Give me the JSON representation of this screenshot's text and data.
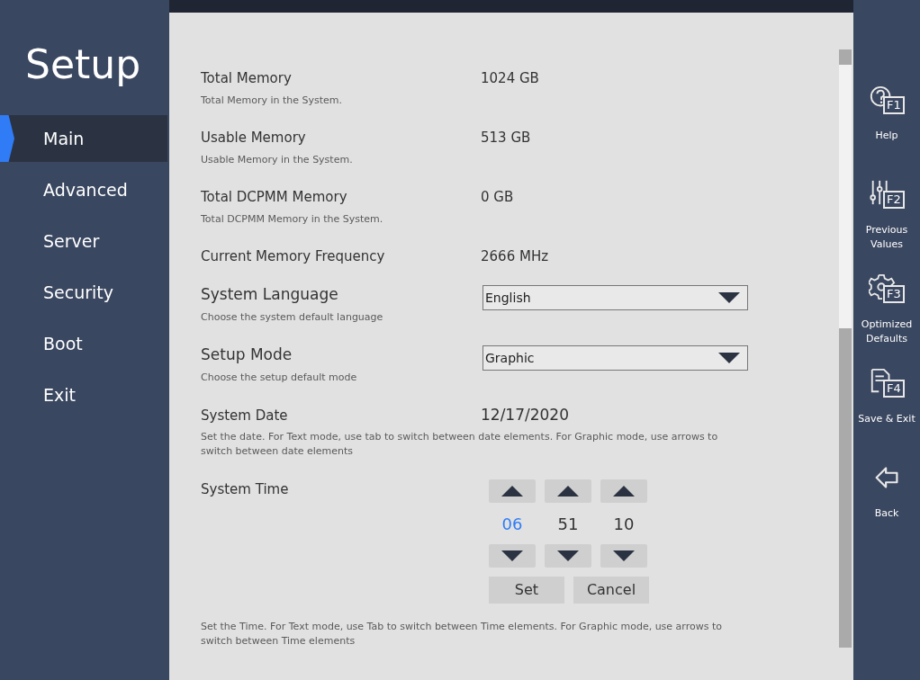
{
  "sidebar": {
    "title": "Setup",
    "items": [
      {
        "label": "Main",
        "selected": true
      },
      {
        "label": "Advanced",
        "selected": false
      },
      {
        "label": "Server",
        "selected": false
      },
      {
        "label": "Security",
        "selected": false
      },
      {
        "label": "Boot",
        "selected": false
      },
      {
        "label": "Exit",
        "selected": false
      }
    ]
  },
  "settings": [
    {
      "kind": "info",
      "label": "Total Memory",
      "value": "1024 GB",
      "help": "Total Memory in the System."
    },
    {
      "kind": "info",
      "label": "Usable Memory",
      "value": "513 GB",
      "help": "Usable Memory in the System."
    },
    {
      "kind": "info",
      "label": "Total DCPMM Memory",
      "value": "0 GB",
      "help": "Total DCPMM Memory in the System."
    },
    {
      "kind": "info",
      "label": "Current Memory Frequency",
      "value": "2666 MHz"
    },
    {
      "kind": "select",
      "label": "System Language",
      "value": "English",
      "help": "Choose the system default language"
    },
    {
      "kind": "select",
      "label": "Setup Mode",
      "value": "Graphic",
      "help": "Choose the setup default mode"
    },
    {
      "kind": "date",
      "label": "System Date",
      "value": "12/17/2020",
      "help": "Set the date. For Text mode, use tab to switch between date elements. For Graphic mode, use arrows to switch between date elements"
    },
    {
      "kind": "time",
      "label": "System Time",
      "fields": [
        {
          "value": "06",
          "selected": true
        },
        {
          "value": "51",
          "selected": false
        },
        {
          "value": "10",
          "selected": false
        }
      ],
      "buttons": [
        "Set",
        "Cancel"
      ],
      "help": "Set the Time. For Text mode, use Tab to switch between Time elements. For Graphic mode, use arrows to switch between Time elements"
    }
  ],
  "toolbar": [
    {
      "kind": "help",
      "key": "F1",
      "label": "Help"
    },
    {
      "kind": "previous",
      "key": "F2",
      "label": "Previous Values"
    },
    {
      "kind": "defaults",
      "key": "F3",
      "label": "Optimized Defaults"
    },
    {
      "kind": "save",
      "key": "F4",
      "label": "Save & Exit"
    },
    {
      "kind": "back",
      "label": "Back"
    }
  ]
}
